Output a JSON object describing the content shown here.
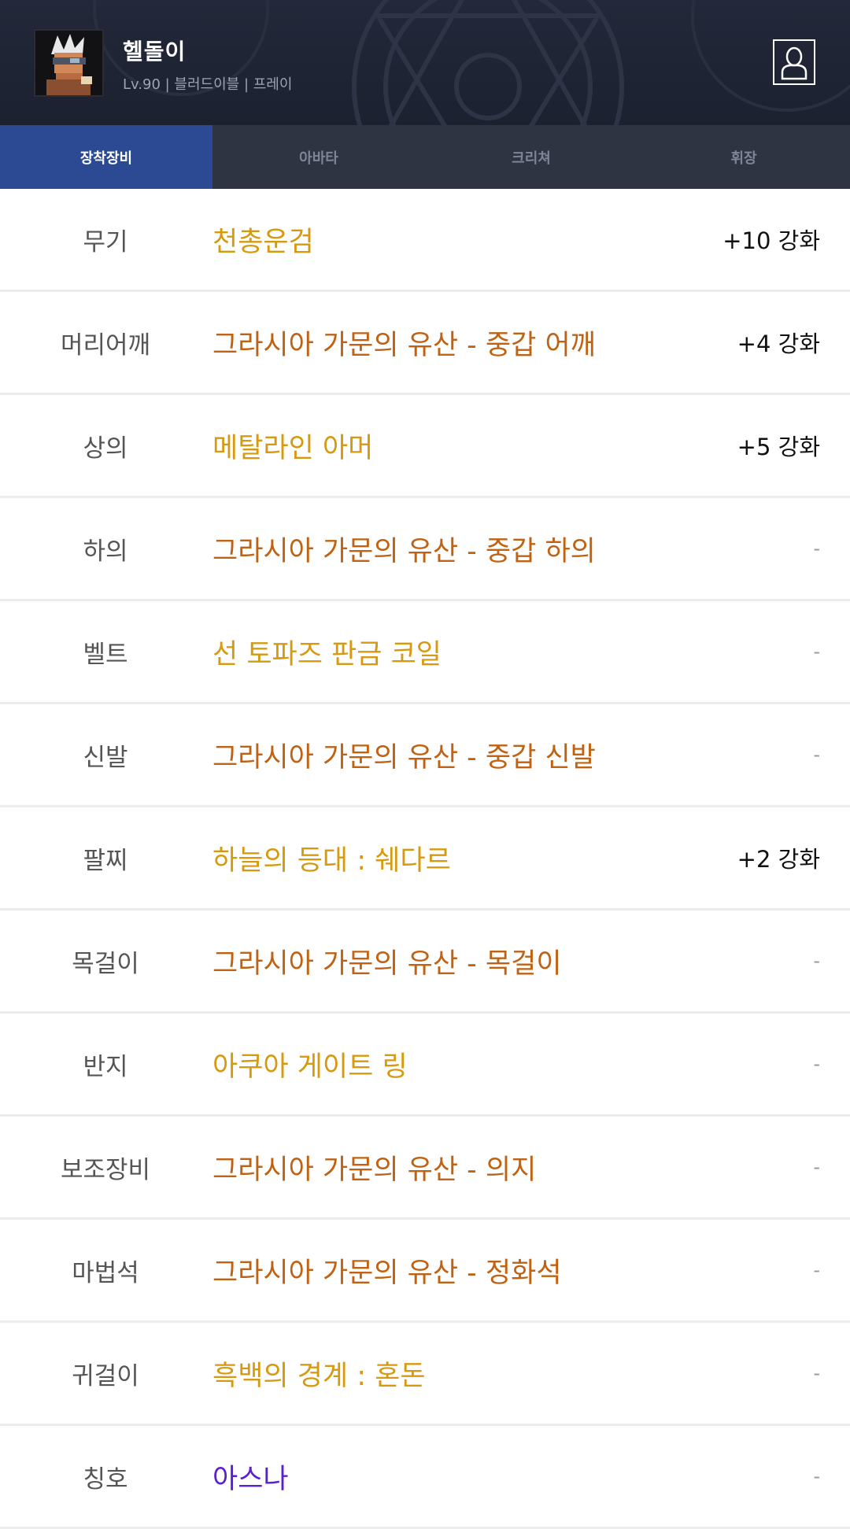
{
  "character": {
    "name": "헬돌이",
    "info": "Lv.90 | 블러드이블 | 프레이",
    "avatar_icon": "character-portrait-icon",
    "profile_icon": "person-profile-icon"
  },
  "tabs": [
    {
      "label": "장착장비",
      "active": true
    },
    {
      "label": "아바타",
      "active": false
    },
    {
      "label": "크리쳐",
      "active": false
    },
    {
      "label": "휘장",
      "active": false
    }
  ],
  "colors": {
    "unique": "#d69a11",
    "epic": "#c06212",
    "title": "#5a1fcf",
    "tab_active": "#2c4a93",
    "header": "#1e2230"
  },
  "equipment": [
    {
      "slot": "무기",
      "item": "천총운검",
      "grade": "unique",
      "enhance": "+10 강화"
    },
    {
      "slot": "머리어깨",
      "item": "그라시아 가문의 유산 - 중갑 어깨",
      "grade": "epic",
      "enhance": "+4 강화"
    },
    {
      "slot": "상의",
      "item": "메탈라인 아머",
      "grade": "unique",
      "enhance": "+5 강화"
    },
    {
      "slot": "하의",
      "item": "그라시아 가문의 유산 - 중갑 하의",
      "grade": "epic",
      "enhance": "-"
    },
    {
      "slot": "벨트",
      "item": "선 토파즈 판금 코일",
      "grade": "unique",
      "enhance": "-"
    },
    {
      "slot": "신발",
      "item": "그라시아 가문의 유산 - 중갑 신발",
      "grade": "epic",
      "enhance": "-"
    },
    {
      "slot": "팔찌",
      "item": "하늘의 등대 : 쉐다르",
      "grade": "unique",
      "enhance": "+2 강화"
    },
    {
      "slot": "목걸이",
      "item": "그라시아 가문의 유산 - 목걸이",
      "grade": "epic",
      "enhance": "-"
    },
    {
      "slot": "반지",
      "item": "아쿠아 게이트 링",
      "grade": "unique",
      "enhance": "-"
    },
    {
      "slot": "보조장비",
      "item": "그라시아 가문의 유산 - 의지",
      "grade": "epic",
      "enhance": "-"
    },
    {
      "slot": "마법석",
      "item": "그라시아 가문의 유산 - 정화석",
      "grade": "epic",
      "enhance": "-"
    },
    {
      "slot": "귀걸이",
      "item": "흑백의 경계 : 혼돈",
      "grade": "unique",
      "enhance": "-"
    },
    {
      "slot": "칭호",
      "item": "아스나",
      "grade": "title",
      "enhance": "-"
    }
  ]
}
